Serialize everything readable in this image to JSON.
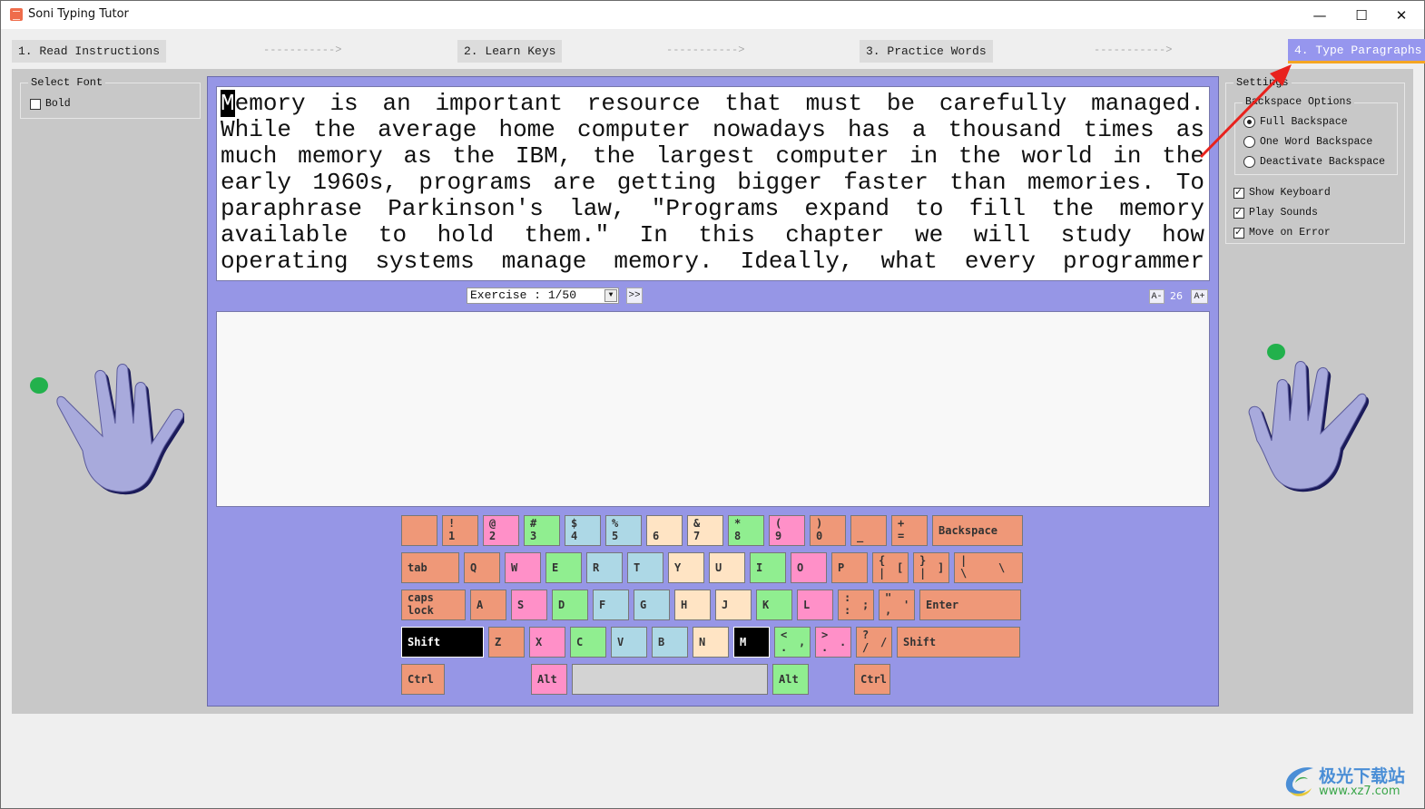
{
  "window": {
    "title": "Soni Typing Tutor",
    "controls": {
      "minimize": "—",
      "maximize": "☐",
      "close": "✕"
    }
  },
  "steps": [
    {
      "label": "1. Read Instructions",
      "active": false
    },
    {
      "label": "2. Learn Keys",
      "active": false
    },
    {
      "label": "3. Practice Words",
      "active": false
    },
    {
      "label": "4. Type Paragraphs",
      "active": true
    }
  ],
  "step_arrow": "----------->",
  "font_panel": {
    "legend": "Select Font",
    "bold_label": "Bold",
    "bold_checked": false
  },
  "settings": {
    "legend": "Settings",
    "backspace_legend": "Backspace Options",
    "backspace_options": [
      {
        "label": "Full Backspace",
        "selected": true
      },
      {
        "label": "One Word Backspace",
        "selected": false
      },
      {
        "label": "Deactivate Backspace",
        "selected": false
      }
    ],
    "toggles": [
      {
        "label": "Show Keyboard",
        "checked": true
      },
      {
        "label": "Play Sounds",
        "checked": true
      },
      {
        "label": "Move on Error",
        "checked": true
      }
    ]
  },
  "paragraph": {
    "cursor_char": "M",
    "first_line_rest": "emory is an important resource that must be carefully managed.",
    "lines": [
      "While the average home computer nowadays has a thousand times as",
      "much memory as the IBM, the largest computer in the world in the",
      "early 1960s, programs are getting bigger faster than memories. To",
      "paraphrase Parkinson's law, \"Programs expand to fill the memory",
      "available to hold them.\" In this chapter we will study how",
      "operating systems manage memory. Ideally, what every programmer"
    ]
  },
  "exercise": {
    "selected": "Exercise : 1/50",
    "next_label": ">>"
  },
  "font_size": {
    "decrease_label": "A-",
    "value": "26",
    "increase_label": "A+"
  },
  "typing_input": {
    "value": ""
  },
  "keyboard": {
    "colors": {
      "orange": "#ef9878",
      "pink": "#ff90c8",
      "green": "#90ee90",
      "blue": "#add8e6",
      "cream": "#ffe4c4",
      "space": "#d3d3d3"
    },
    "highlighted_keys": [
      "Shift-left",
      "M"
    ],
    "rows": [
      [
        {
          "top": "",
          "bot": "",
          "color": "orange"
        },
        {
          "top": "!",
          "bot": "1",
          "color": "orange"
        },
        {
          "top": "@",
          "bot": "2",
          "color": "pink"
        },
        {
          "top": "#",
          "bot": "3",
          "color": "green"
        },
        {
          "top": "$",
          "bot": "4",
          "color": "blue"
        },
        {
          "top": "%",
          "bot": "5",
          "color": "blue"
        },
        {
          "top": "",
          "bot": "6",
          "color": "cream"
        },
        {
          "top": "&",
          "bot": "7",
          "color": "cream"
        },
        {
          "top": "*",
          "bot": "8",
          "color": "green"
        },
        {
          "top": "(",
          "bot": "9",
          "color": "pink"
        },
        {
          "top": ")",
          "bot": "0",
          "color": "orange"
        },
        {
          "top": "",
          "bot": "_",
          "color": "orange"
        },
        {
          "top": "+",
          "bot": "=",
          "color": "orange"
        },
        {
          "mid": "Backspace",
          "color": "orange"
        }
      ],
      [
        {
          "mid": "tab",
          "color": "orange"
        },
        {
          "mid": "Q",
          "color": "orange"
        },
        {
          "mid": "W",
          "color": "pink"
        },
        {
          "mid": "E",
          "color": "green"
        },
        {
          "mid": "R",
          "color": "blue"
        },
        {
          "mid": "T",
          "color": "blue"
        },
        {
          "mid": "Y",
          "color": "cream"
        },
        {
          "mid": "U",
          "color": "cream"
        },
        {
          "mid": "I",
          "color": "green"
        },
        {
          "mid": "O",
          "color": "pink"
        },
        {
          "mid": "P",
          "color": "orange"
        },
        {
          "top": "{",
          "bot": "|",
          "right": "[",
          "color": "orange"
        },
        {
          "top": "}",
          "bot": "|",
          "right": "]",
          "color": "orange"
        },
        {
          "top": "|",
          "bot": "\\",
          "right": "\\",
          "color": "orange"
        }
      ],
      [
        {
          "top": "caps",
          "bot": "lock",
          "color": "orange"
        },
        {
          "mid": "A",
          "color": "orange"
        },
        {
          "mid": "S",
          "color": "pink"
        },
        {
          "mid": "D",
          "color": "green"
        },
        {
          "mid": "F",
          "color": "blue"
        },
        {
          "mid": "G",
          "color": "blue"
        },
        {
          "mid": "H",
          "color": "cream"
        },
        {
          "mid": "J",
          "color": "cream"
        },
        {
          "mid": "K",
          "color": "green"
        },
        {
          "mid": "L",
          "color": "pink"
        },
        {
          "top": ":",
          "bot": ":",
          "right": ";",
          "color": "orange"
        },
        {
          "top": "\"",
          "bot": ",",
          "right": "'",
          "color": "orange"
        },
        {
          "mid": "Enter",
          "color": "orange"
        }
      ],
      [
        {
          "mid": "Shift",
          "color": "black"
        },
        {
          "mid": "Z",
          "color": "orange"
        },
        {
          "mid": "X",
          "color": "pink"
        },
        {
          "mid": "C",
          "color": "green"
        },
        {
          "mid": "V",
          "color": "blue"
        },
        {
          "mid": "B",
          "color": "blue"
        },
        {
          "mid": "N",
          "color": "cream"
        },
        {
          "mid": "M",
          "color": "black"
        },
        {
          "top": "<",
          "bot": ".",
          "right": ",",
          "color": "green"
        },
        {
          "top": ">",
          "bot": ".",
          "right": ".",
          "color": "pink"
        },
        {
          "top": "?",
          "bot": "/",
          "right": "/",
          "color": "orange"
        },
        {
          "mid": "Shift",
          "color": "orange"
        }
      ],
      [
        {
          "mid": "Ctrl",
          "color": "orange"
        },
        {
          "mid": "Alt",
          "color": "pink"
        },
        {
          "mid": "",
          "color": "space"
        },
        {
          "mid": "Alt",
          "color": "green"
        },
        {
          "mid": "Ctrl",
          "color": "orange"
        }
      ]
    ]
  },
  "hands": {
    "left_active_finger": "little",
    "right_active_finger": "index"
  },
  "watermark": {
    "title": "极光下载站",
    "url": "www.xz7.com"
  }
}
